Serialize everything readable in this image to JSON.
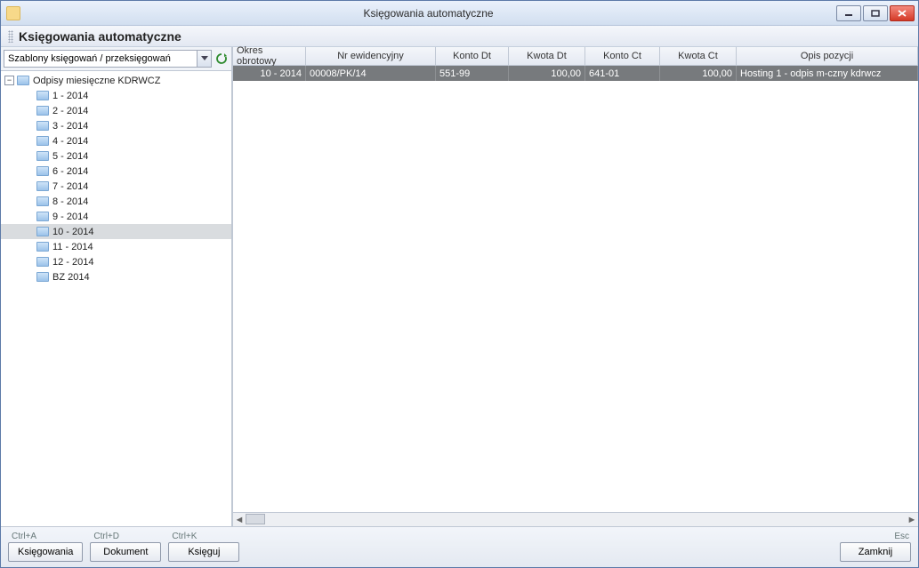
{
  "window": {
    "title": "Księgowania automatyczne",
    "header": "Księgowania automatyczne"
  },
  "combo": {
    "value": "Szablony księgowań / przeksięgowań"
  },
  "tree": {
    "root_label": "Odpisy miesięczne KDRWCZ",
    "items": [
      {
        "label": "1 - 2014",
        "selected": false
      },
      {
        "label": "2 - 2014",
        "selected": false
      },
      {
        "label": "3 - 2014",
        "selected": false
      },
      {
        "label": "4 - 2014",
        "selected": false
      },
      {
        "label": "5 - 2014",
        "selected": false
      },
      {
        "label": "6 - 2014",
        "selected": false
      },
      {
        "label": "7 - 2014",
        "selected": false
      },
      {
        "label": "8 - 2014",
        "selected": false
      },
      {
        "label": "9 - 2014",
        "selected": false
      },
      {
        "label": "10 - 2014",
        "selected": true
      },
      {
        "label": "11 - 2014",
        "selected": false
      },
      {
        "label": "12 - 2014",
        "selected": false
      },
      {
        "label": "BZ 2014",
        "selected": false
      }
    ]
  },
  "grid": {
    "columns": [
      "Okres obrotowy",
      "Nr ewidencyjny",
      "Konto Dt",
      "Kwota Dt",
      "Konto Ct",
      "Kwota Ct",
      "Opis pozycji"
    ],
    "rows": [
      {
        "okres": "10 - 2014",
        "nr": "00008/PK/14",
        "konto_dt": "551-99",
        "kwota_dt": "100,00",
        "konto_ct": "641-01",
        "kwota_ct": "100,00",
        "opis": "Hosting 1 - odpis m-czny kdrwcz"
      }
    ]
  },
  "footer": {
    "ksiegowania": {
      "shortcut": "Ctrl+A",
      "label": "Księgowania"
    },
    "dokument": {
      "shortcut": "Ctrl+D",
      "label": "Dokument"
    },
    "ksieguj": {
      "shortcut": "Ctrl+K",
      "label": "Księguj"
    },
    "zamknij": {
      "shortcut": "Esc",
      "label": "Zamknij"
    }
  }
}
